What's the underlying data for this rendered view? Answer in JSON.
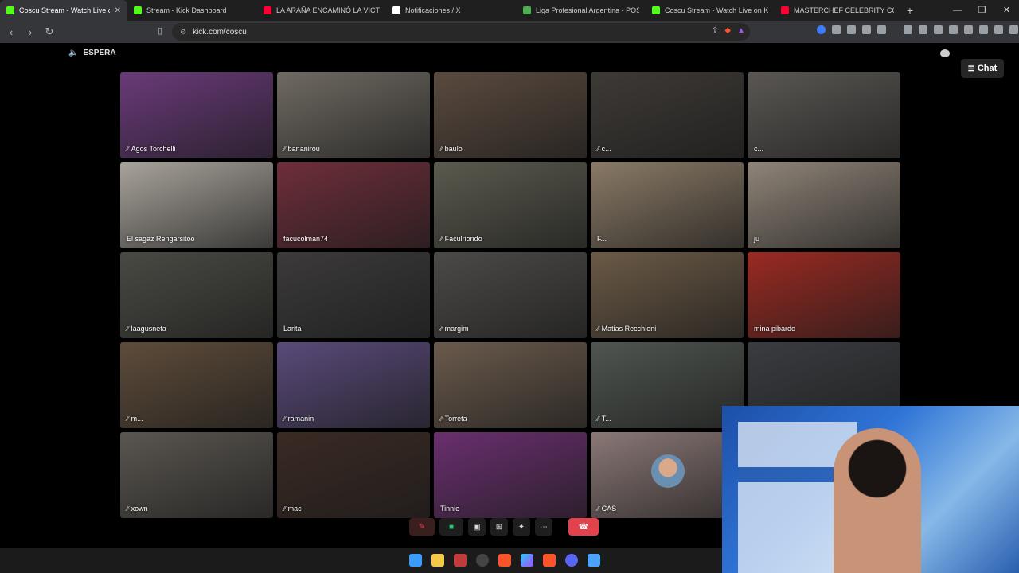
{
  "browser": {
    "tabs": [
      {
        "title": "Coscu Stream - Watch Live o",
        "color": "#53fc18",
        "active": true
      },
      {
        "title": "Stream - Kick Dashboard",
        "color": "#53fc18",
        "active": false
      },
      {
        "title": "LA ARAÑA ENCAMINÓ LA VICTORIA",
        "color": "#ff0033",
        "active": false
      },
      {
        "title": "Notificaciones / X",
        "color": "#ffffff",
        "active": false
      },
      {
        "title": "Liga Profesional Argentina - POSICIO",
        "color": "#4caf50",
        "active": false
      },
      {
        "title": "Coscu Stream - Watch Live on Kick",
        "color": "#53fc18",
        "active": false
      },
      {
        "title": "MASTERCHEF CELEBRITY CON GREG",
        "color": "#ff0033",
        "active": false
      }
    ],
    "url": "kick.com/coscu"
  },
  "page": {
    "status_label": "ESPERA",
    "chat_label": "Chat"
  },
  "participants": [
    {
      "name": "Agos Torchelli",
      "muted": true,
      "bg": "#6a3a7a"
    },
    {
      "name": "bananirou",
      "muted": true,
      "bg": "#6f6a62"
    },
    {
      "name": "baulo",
      "muted": true,
      "bg": "#5a4a3e"
    },
    {
      "name": "c...",
      "muted": true,
      "bg": "#3e3a36"
    },
    {
      "name": "c...",
      "muted": false,
      "bg": "#5a5753"
    },
    {
      "name": "El sagaz Rengarsitoo",
      "muted": false,
      "bg": "#a8a39b"
    },
    {
      "name": "facucolman74",
      "muted": false,
      "bg": "#6e2e3a"
    },
    {
      "name": "Faculriondo",
      "muted": true,
      "bg": "#5b5a4e"
    },
    {
      "name": "F...",
      "muted": false,
      "bg": "#8a7a66"
    },
    {
      "name": "ju",
      "muted": false,
      "bg": "#8f8478"
    },
    {
      "name": "laagusneta",
      "muted": true,
      "bg": "#4a4a44"
    },
    {
      "name": "Larita",
      "muted": false,
      "bg": "#3c3a3b"
    },
    {
      "name": "margim",
      "muted": true,
      "bg": "#4c4a48"
    },
    {
      "name": "Matias Recchioni",
      "muted": true,
      "bg": "#6b5a46"
    },
    {
      "name": "mina pibardo",
      "muted": false,
      "bg": "#9a2a22"
    },
    {
      "name": "m...",
      "muted": true,
      "bg": "#5e4c3a"
    },
    {
      "name": "ramanin",
      "muted": true,
      "bg": "#5a4a7a"
    },
    {
      "name": "Torreta",
      "muted": true,
      "bg": "#6a5a4c"
    },
    {
      "name": "T...",
      "muted": true,
      "bg": "#4f5550"
    },
    {
      "name": "",
      "muted": false,
      "bg": "#3a3c40"
    },
    {
      "name": "xown",
      "muted": true,
      "bg": "#5a5650"
    },
    {
      "name": "mac",
      "muted": true,
      "bg": "#3a2a24"
    },
    {
      "name": "Tinnie",
      "muted": false,
      "bg": "#6a2f6f"
    },
    {
      "name": "CAS",
      "muted": true,
      "bg": "#8a7876",
      "avatar": true
    }
  ],
  "controls": {
    "mic_icon": "mic-off-icon",
    "camera_icon": "camera-icon",
    "share_icon": "screen-share-icon",
    "grid_icon": "layout-grid-icon",
    "effects_icon": "effects-icon",
    "more_icon": "more-icon",
    "end_icon": "end-call-icon"
  },
  "accent_colors": {
    "end_call": "#e0434b",
    "camera_on": "#2ec770"
  }
}
